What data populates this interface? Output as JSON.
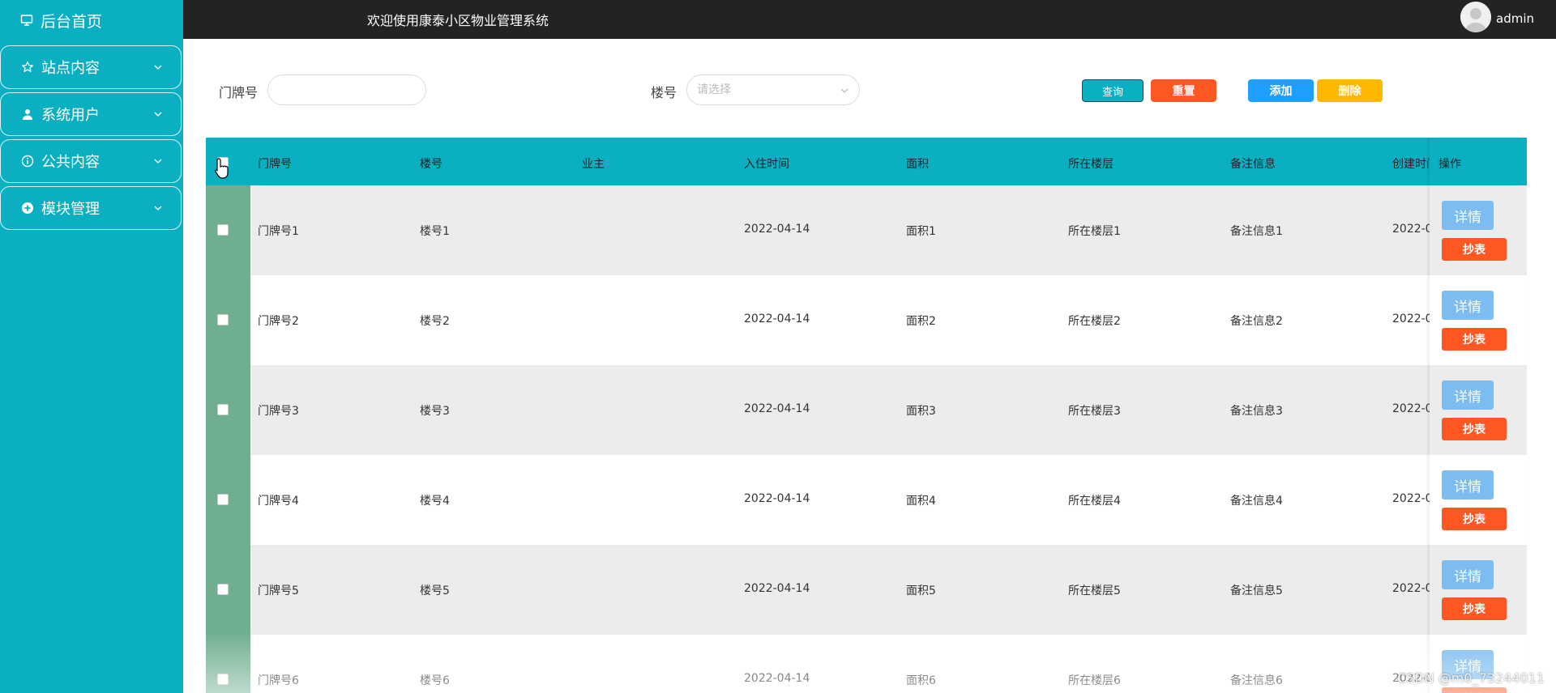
{
  "sidebar": {
    "home_label": "后台首页",
    "menus": [
      {
        "label": "站点内容",
        "icon": "star-icon"
      },
      {
        "label": "系统用户",
        "icon": "user-icon"
      },
      {
        "label": "公共内容",
        "icon": "info-icon"
      },
      {
        "label": "模块管理",
        "icon": "plus-circle-icon"
      }
    ]
  },
  "topbar": {
    "title": "欢迎使用康泰小区物业管理系统",
    "username": "admin"
  },
  "search": {
    "door_label": "门牌号",
    "door_value": "",
    "building_label": "楼号",
    "building_placeholder": "请选择"
  },
  "buttons": {
    "query": "查询",
    "reset": "重置",
    "add": "添加",
    "delete": "删除"
  },
  "table": {
    "headers": [
      "门牌号",
      "楼号",
      "业主",
      "入住时间",
      "面积",
      "所在楼层",
      "备注信息",
      "创建时间",
      "操作"
    ],
    "rows": [
      [
        "门牌号1",
        "楼号1",
        "",
        "2022-04-14",
        "面积1",
        "所在楼层1",
        "备注信息1",
        "2022-0"
      ],
      [
        "门牌号2",
        "楼号2",
        "",
        "2022-04-14",
        "面积2",
        "所在楼层2",
        "备注信息2",
        "2022-0"
      ],
      [
        "门牌号3",
        "楼号3",
        "",
        "2022-04-14",
        "面积3",
        "所在楼层3",
        "备注信息3",
        "2022-0"
      ],
      [
        "门牌号4",
        "楼号4",
        "",
        "2022-04-14",
        "面积4",
        "所在楼层4",
        "备注信息4",
        "2022-0"
      ],
      [
        "门牌号5",
        "楼号5",
        "",
        "2022-04-14",
        "面积5",
        "所在楼层5",
        "备注信息5",
        "2022-0"
      ],
      [
        "门牌号6",
        "楼号6",
        "",
        "2022-04-14",
        "面积6",
        "所在楼层6",
        "备注信息6",
        "2022-0"
      ]
    ],
    "detail_label": "详情",
    "meter_label": "抄表"
  },
  "watermark": "CSDN @m0_73244011",
  "colors": {
    "sidebar": "#0aafc2",
    "topbar": "#232323",
    "table_header": "#0aafc2",
    "checkbox_column": "#6fae8f",
    "reset": "#ff5722",
    "add": "#1e9fff",
    "delete": "#ffb800",
    "detail": "#7dbcf0"
  }
}
